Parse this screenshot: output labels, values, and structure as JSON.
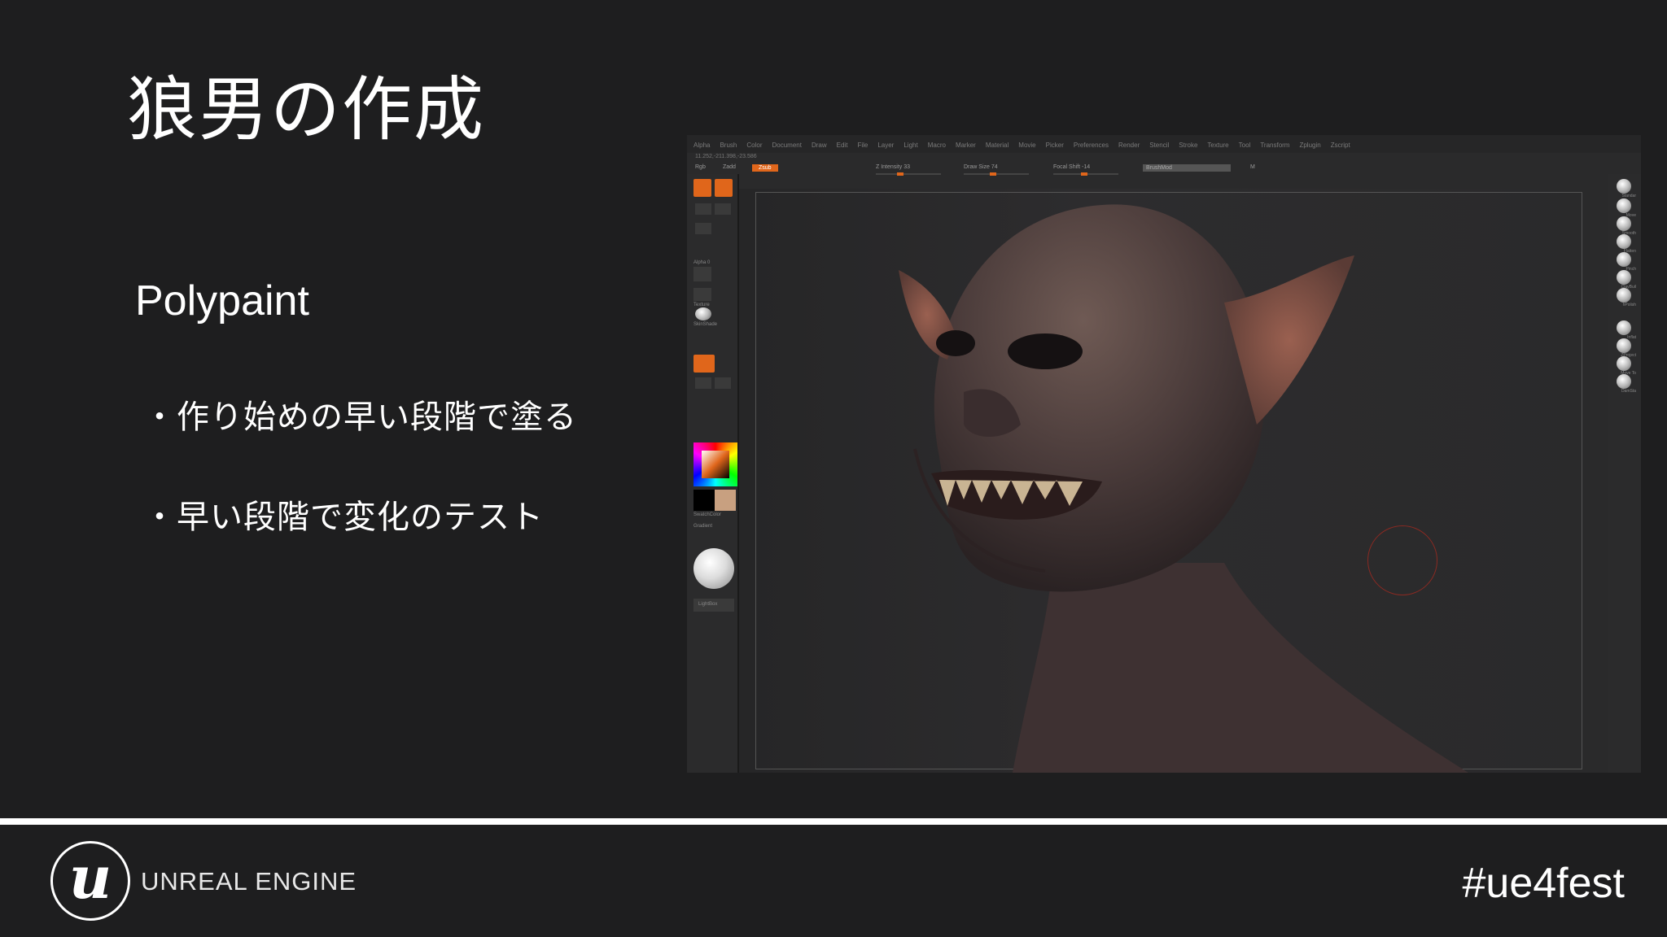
{
  "slide": {
    "title": "狼男の作成",
    "subtitle": "Polypaint",
    "bullets": [
      "・作り始めの早い段階で塗る",
      "・早い段階で変化のテスト"
    ]
  },
  "zbrush": {
    "menu": [
      "Alpha",
      "Brush",
      "Color",
      "Document",
      "Draw",
      "Edit",
      "File",
      "Layer",
      "Light",
      "Macro",
      "Marker",
      "Material",
      "Movie",
      "Picker",
      "Preferences",
      "Render",
      "Stencil",
      "Stroke",
      "Texture",
      "Tool",
      "Transform",
      "Zplugin",
      "Zscript"
    ],
    "coords": "11.252,-211.398,-23.586",
    "toolbar": {
      "zbrush": "Rgb",
      "zadd": "Zadd",
      "zsub": "Zsub",
      "intensity": "Z Intensity 33",
      "draw_size": "Draw Size 74",
      "focal": "Focal Shift -14",
      "brushmod": "BrushMod",
      "m": "M"
    },
    "left_labels": {
      "alpha": "Alpha 0",
      "texture": "Texture",
      "material": "SkinShade",
      "swatch": "SwatchColor",
      "gradient": "Gradient",
      "lightbox": "LightBox"
    },
    "right_brushes": [
      "Standar",
      "Move",
      "Smooth",
      "Flatten",
      "Pinch",
      "ClayBuil",
      "hPolish",
      "Inflat",
      "ZProject",
      "Move To",
      "DamSta"
    ]
  },
  "footer": {
    "brand": "UNREAL ENGINE",
    "logo_letter": "u",
    "hashtag": "#ue4fest"
  },
  "colors": {
    "background": "#1e1e1f",
    "accent": "#e0661b"
  }
}
